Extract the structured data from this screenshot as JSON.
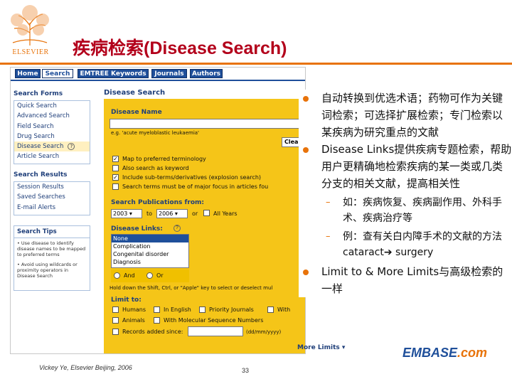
{
  "slide": {
    "title": "疾病检索(Disease Search)",
    "logo_text": "ELSEVIER",
    "footer_author": "Vickey Ye, Elsevier Beijing, 2006",
    "page_number": "33",
    "brand": {
      "name": "EMBASE",
      "suffix": ".com"
    },
    "colors": {
      "title": "#b3001b",
      "accent": "#e8730a",
      "nav": "#1f4f9a",
      "form_bg": "#f5c518"
    }
  },
  "nav_tabs": [
    {
      "label": "Home"
    },
    {
      "label": "Search"
    },
    {
      "label": "EMTREE Keywords"
    },
    {
      "label": "Journals"
    },
    {
      "label": "Authors"
    }
  ],
  "sidebar": {
    "search_forms_title": "Search Forms",
    "search_forms": [
      {
        "label": "Quick Search"
      },
      {
        "label": "Advanced Search"
      },
      {
        "label": "Field Search"
      },
      {
        "label": "Drug Search"
      },
      {
        "label": "Disease Search"
      },
      {
        "label": "Article Search"
      }
    ],
    "search_results_title": "Search Results",
    "search_results": [
      {
        "label": "Session Results"
      },
      {
        "label": "Saved Searches"
      },
      {
        "label": "E-mail Alerts"
      }
    ],
    "tips_title": "Search Tips",
    "tips": [
      "• Use disease to identify disease names to be mapped to preferred terms",
      "• Avoid using wildcards or proximity operators in Disease Search"
    ]
  },
  "form": {
    "heading": "Disease Search",
    "disease_name_label": "Disease Name",
    "example": "e.g. 'acute myeloblastic leukaemia'",
    "clear_label": "Clea",
    "options": [
      {
        "label": "Map to preferred terminology",
        "checked": "✓"
      },
      {
        "label": "Also search as keyword",
        "checked": ""
      },
      {
        "label": "Include sub-terms/derivatives (explosion search)",
        "checked": "✓"
      },
      {
        "label": "Search terms must be of major focus in articles fou",
        "checked": ""
      }
    ],
    "publications_label": "Search Publications from:",
    "year_from": "2003",
    "to_label": "to",
    "year_to": "2006",
    "or_label": "or",
    "all_years": "All Years",
    "disease_links_label": "Disease Links:",
    "disease_links": [
      {
        "label": "None",
        "selected": true
      },
      {
        "label": "Complication",
        "selected": false
      },
      {
        "label": "Congenital disorder",
        "selected": false
      },
      {
        "label": "Diagnosis",
        "selected": false
      }
    ],
    "and_label": "And",
    "or_radio_label": "Or",
    "hold_down_text": "Hold down the Shift, Ctrl, or \"Apple\" key to select or deselect mul",
    "limit_to_label": "Limit to:",
    "limits_row1": [
      "Humans",
      "In English",
      "Priority Journals",
      "With"
    ],
    "limits_row2": [
      "Animals",
      "With Molecular Sequence Numbers"
    ],
    "records_added": "Records added since:",
    "date_format": "(dd/mm/yyyy)",
    "more_limits": "More Limits"
  },
  "bullets": [
    {
      "type": "main",
      "text": "自动转换到优选术语；药物可作为关键词检索；可选择扩展检索；专门检索以某疾病为研究重点的文献"
    },
    {
      "type": "main",
      "text": "Disease Links提供疾病专题检索，帮助用户更精确地检索疾病的某一类或几类分支的相关文献，提高相关性"
    },
    {
      "type": "sub",
      "text": "如：疾病恢复、疾病副作用、外科手术、疾病治疗等"
    },
    {
      "type": "sub",
      "text_before": "例：查有关白内障手术的文献的方法 cataract",
      "arrow": "➔",
      "text_after": " surgery"
    },
    {
      "type": "main",
      "text": "Limit to & More Limits与高级检索的一样"
    }
  ]
}
